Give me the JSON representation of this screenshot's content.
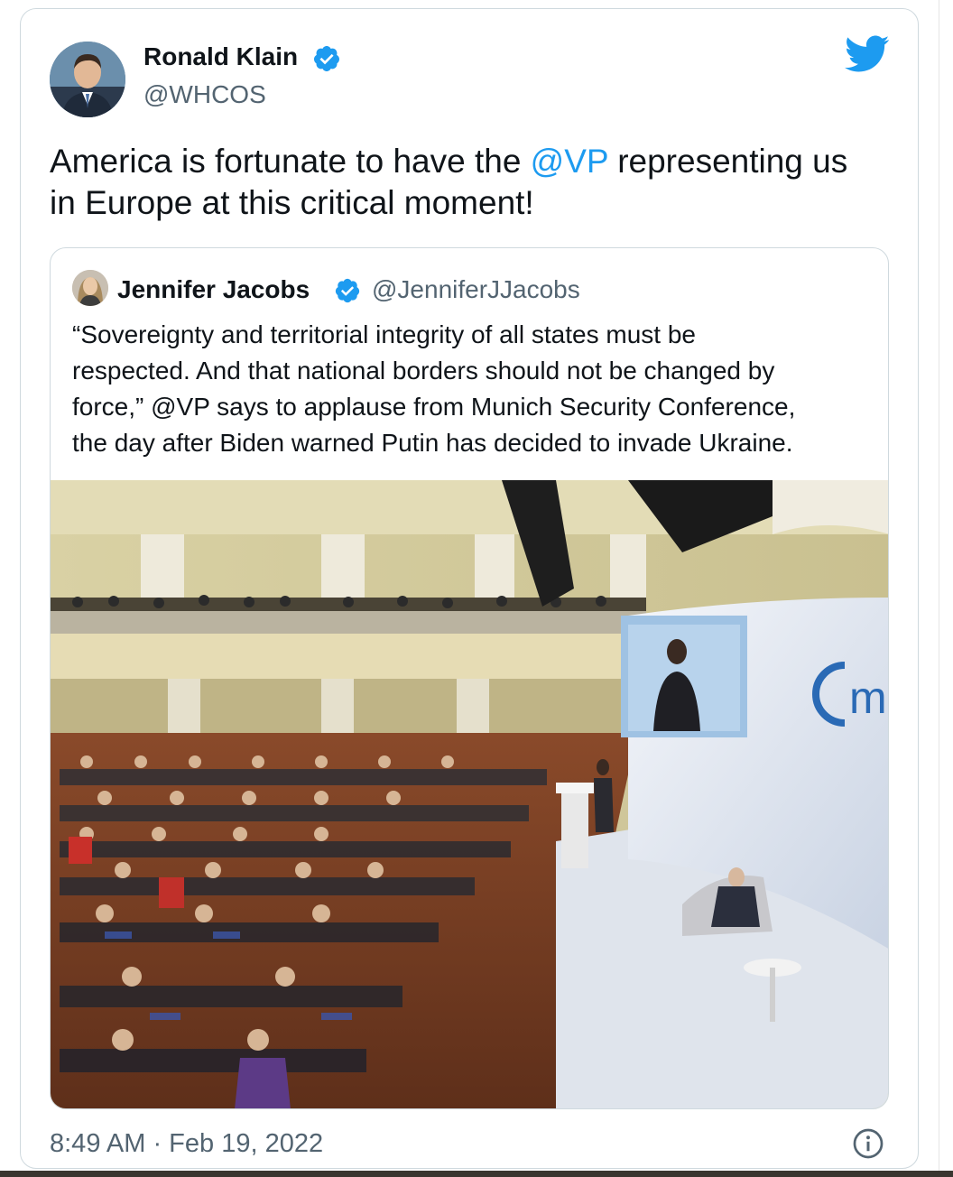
{
  "author": {
    "name": "Ronald Klain",
    "handle": "@WHCOS",
    "avatar_icon": "profile-photo"
  },
  "tweet": {
    "text_before": "America is fortunate to have the ",
    "mention": "@VP",
    "text_after": " representing us",
    "text_line2": "in Europe at this critical moment!"
  },
  "quoted": {
    "name": "Jennifer Jacobs",
    "handle": "@JenniferJJacobs",
    "lines": [
      "“Sovereignty and territorial integrity of all states must be",
      "respected. And that national borders should not be changed by",
      "force,” @VP says to applause from Munich Security Conference,",
      "the day after Biden warned Putin has decided to invade Ukraine."
    ],
    "photo": {
      "screen_logo": "msc"
    }
  },
  "footer": {
    "timestamp": "8:49 AM · Feb 19, 2022",
    "info_icon": "info-icon"
  },
  "colors": {
    "accent": "#1d9bf0",
    "secondary_text": "#536471",
    "border": "#cfd9de"
  }
}
